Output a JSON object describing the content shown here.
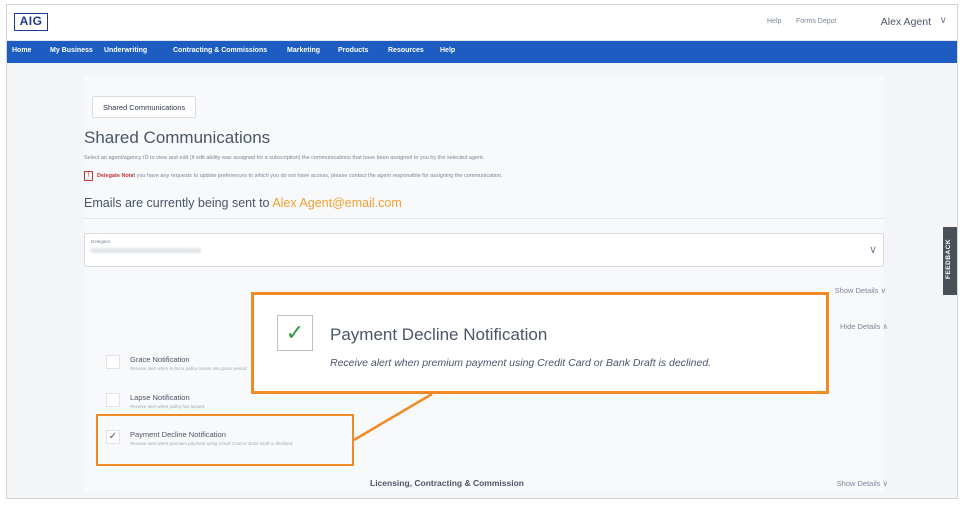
{
  "header": {
    "logo": "AIG",
    "util_links": [
      "Help",
      "Forms Depot"
    ],
    "user_name": "Alex Agent",
    "user_chevron": "∨"
  },
  "nav": {
    "items": [
      "Home",
      "My Business",
      "Underwriting",
      "Contracting & Commissions",
      "Marketing",
      "Products",
      "Resources",
      "Help"
    ]
  },
  "page": {
    "tab_label": "Shared Communications",
    "title": "Shared Communications",
    "description": "Select an agent/agency ID to view and edit (if edit ability was assigned for a subscription) the communications that have been assigned to you by the selected agent.",
    "note_bold": "Delegate Note:",
    "note_text": "If you have any requests to update preferences to which you do not have access, please contact the agent responsible for assigning the communication.",
    "emails_prefix": "Emails are currently being sent to",
    "emails_address": "Alex Agent@email.com",
    "delegator_label": "Delegator",
    "show_details": "Show Details",
    "hide_details": "Hide Details",
    "section_title": "Licensing, Contracting & Commission"
  },
  "notifications": [
    {
      "title": "Grace Notification",
      "desc": "Receive alert when in force policy moves into grace period.",
      "checked": false
    },
    {
      "title": "Lapse Notification",
      "desc": "Receive alert when policy has lapsed.",
      "checked": false
    },
    {
      "title": "Payment Decline Notification",
      "desc": "Receive alert when premium payment using Credit Card or Bank Draft is declined.",
      "checked": true
    }
  ],
  "callout": {
    "title": "Payment Decline Notification",
    "desc": "Receive alert when premium payment using Credit Card or Bank Draft is declined."
  },
  "feedback_label": "FEEDBACK",
  "colors": {
    "nav_blue": "#1d5dc1",
    "highlight_orange": "#f08a24",
    "email_orange": "#f0a030",
    "check_green": "#2f9a3c"
  }
}
